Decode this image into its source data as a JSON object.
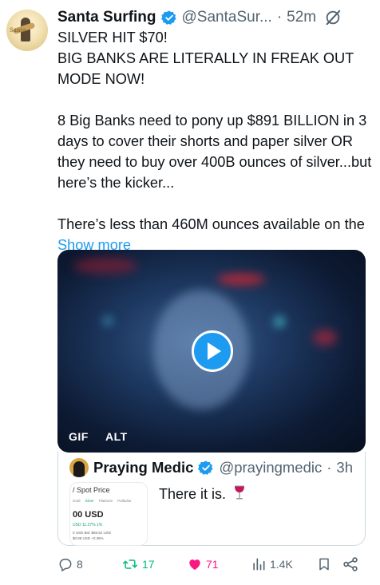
{
  "tweet": {
    "author": {
      "display_name": "Santa Surfing",
      "handle": "@SantaSur...",
      "separator": "·",
      "time": "52m",
      "avatar_label": "Santa"
    },
    "text": {
      "p1": "SILVER HIT $70!\nBIG BANKS ARE LITERALLY IN FREAK OUT MODE NOW!",
      "p2": "8 Big Banks need to pony up $891 BILLION in 3 days to cover their shorts and paper silver OR they need to buy over 400B ounces of silver...but here’s the kicker...",
      "p3_start": "There’s less than 460M ounces available on the ",
      "show_more": "Show more"
    },
    "media": {
      "badge_gif": "GIF",
      "badge_alt": "ALT"
    },
    "quote": {
      "display_name": "Praying Medic",
      "handle": "@prayingmedic",
      "separator": "·",
      "time": "3h",
      "text": "There it is.",
      "thumb": {
        "title": "/ Spot Price",
        "tab_gold": "Gold",
        "tab_silver": "Silver",
        "tab_platinum": "Platinum",
        "tab_palladium": "Palladiur",
        "price": "00 USD",
        "change": "USD  11.27%  1%",
        "meta1": "0 USD  Bid: $68.52 USD",
        "meta2": "$0.88 USD +0.38%"
      }
    },
    "actions": {
      "replies": "8",
      "reposts": "17",
      "likes": "71",
      "views": "1.4K"
    },
    "colors": {
      "accent": "#1d9bf0",
      "repost": "#00ba7c",
      "like": "#f91880",
      "muted": "#536471"
    },
    "icons": [
      "verified-badge-icon",
      "grok-icon",
      "play-icon",
      "wine-glass-icon",
      "reply-icon",
      "repost-icon",
      "heart-icon",
      "views-icon",
      "bookmark-icon",
      "share-icon"
    ]
  }
}
